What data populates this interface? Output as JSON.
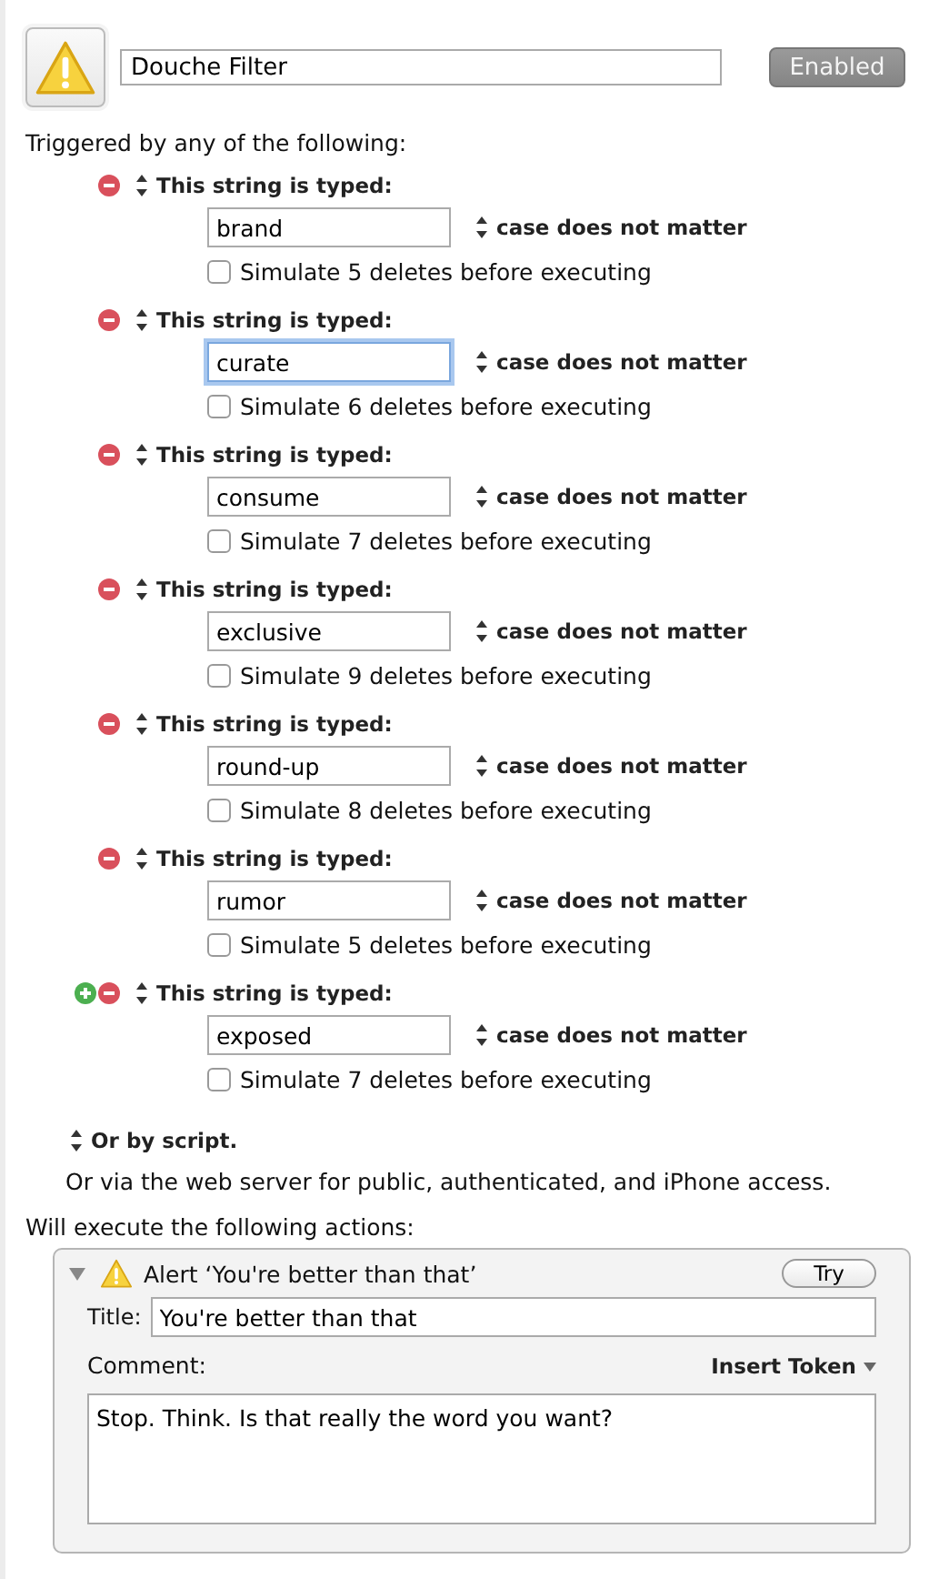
{
  "macro": {
    "name": "Douche Filter",
    "enabled_button": "Enabled"
  },
  "triggers_heading": "Triggered by any of the following:",
  "triggers": [
    {
      "type_label": "This string is typed:",
      "value": "brand",
      "focused": false,
      "case_option": "case does not matter",
      "simulate_label": "Simulate 5 deletes before executing",
      "checked": false,
      "can_add": false
    },
    {
      "type_label": "This string is typed:",
      "value": "curate",
      "focused": true,
      "case_option": "case does not matter",
      "simulate_label": "Simulate 6 deletes before executing",
      "checked": false,
      "can_add": false
    },
    {
      "type_label": "This string is typed:",
      "value": "consume",
      "focused": false,
      "case_option": "case does not matter",
      "simulate_label": "Simulate 7 deletes before executing",
      "checked": false,
      "can_add": false
    },
    {
      "type_label": "This string is typed:",
      "value": "exclusive",
      "focused": false,
      "case_option": "case does not matter",
      "simulate_label": "Simulate 9 deletes before executing",
      "checked": false,
      "can_add": false
    },
    {
      "type_label": "This string is typed:",
      "value": "round-up",
      "focused": false,
      "case_option": "case does not matter",
      "simulate_label": "Simulate 8 deletes before executing",
      "checked": false,
      "can_add": false
    },
    {
      "type_label": "This string is typed:",
      "value": "rumor",
      "focused": false,
      "case_option": "case does not matter",
      "simulate_label": "Simulate 5 deletes before executing",
      "checked": false,
      "can_add": false
    },
    {
      "type_label": "This string is typed:",
      "value": "exposed",
      "focused": false,
      "case_option": "case does not matter",
      "simulate_label": "Simulate 7 deletes before executing",
      "checked": false,
      "can_add": true
    }
  ],
  "script_option": "Or by script.",
  "web_server_note": "Or via the web server for public, authenticated, and iPhone access.",
  "actions_heading": "Will execute the following actions:",
  "action": {
    "expanded": true,
    "title": "Alert ‘You're better than that’",
    "try_button": "Try",
    "title_label": "Title:",
    "title_value": "You're better than that",
    "comment_label": "Comment:",
    "insert_token": "Insert Token",
    "comment_value": "Stop. Think. Is that really the word you want?"
  }
}
